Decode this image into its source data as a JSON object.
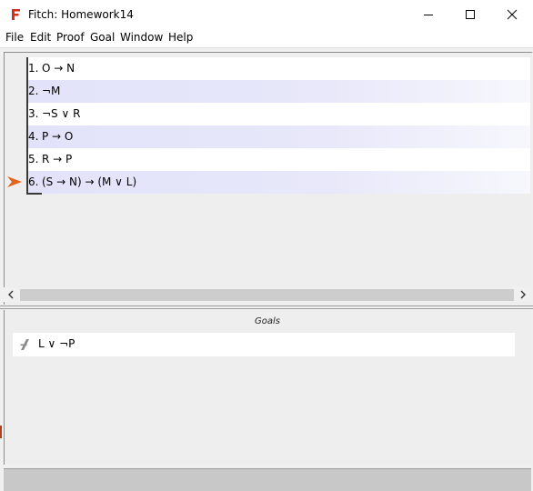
{
  "window": {
    "title": "Fitch: Homework14",
    "controls": [
      "minimize",
      "maximize",
      "close"
    ]
  },
  "menu": {
    "items": [
      "File",
      "Edit",
      "Proof",
      "Goal",
      "Window",
      "Help"
    ]
  },
  "proof": {
    "lines": [
      {
        "num": "1.",
        "formula": "O → N"
      },
      {
        "num": "2.",
        "formula": "¬M"
      },
      {
        "num": "3.",
        "formula": "¬S ∨ R"
      },
      {
        "num": "4.",
        "formula": "P → O"
      },
      {
        "num": "5.",
        "formula": "R → P"
      },
      {
        "num": "6.",
        "formula": "(S → N) → (M ∨ L)"
      }
    ],
    "focus_line": 6
  },
  "goals": {
    "heading": "Goals",
    "items": [
      {
        "formula": "L ∨ ¬P"
      }
    ]
  },
  "colors": {
    "app_icon": "#d32f1e",
    "focus_arrow": "#e0641a",
    "row_alt": "#e2e2fa",
    "proof_bar": "#3a3a3a"
  }
}
